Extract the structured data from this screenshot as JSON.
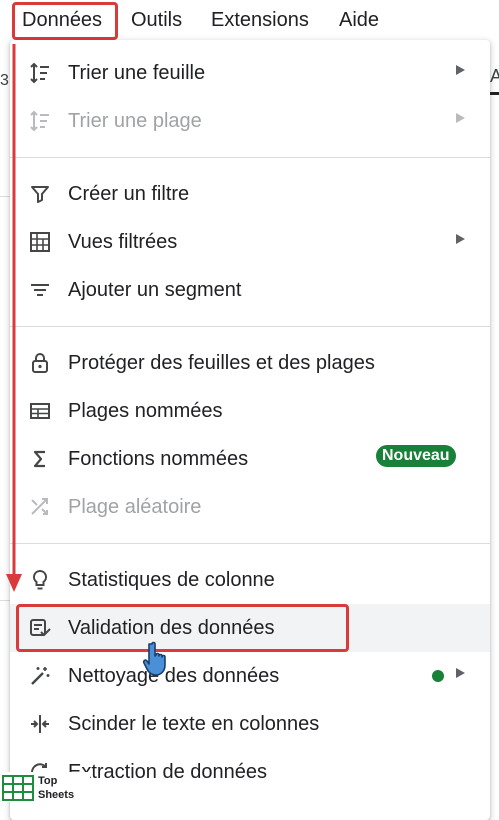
{
  "menubar": {
    "donnees": "Données",
    "outils": "Outils",
    "extensions": "Extensions",
    "aide": "Aide"
  },
  "background": {
    "left_fragment": "3",
    "right_fragment": "A"
  },
  "menu": {
    "trier_feuille": "Trier une feuille",
    "trier_plage": "Trier une plage",
    "creer_filtre": "Créer un filtre",
    "vues_filtrees": "Vues filtrées",
    "ajouter_segment": "Ajouter un segment",
    "proteger": "Protéger des feuilles et des plages",
    "plages_nommees": "Plages nommées",
    "fonctions_nommees": "Fonctions nommées",
    "nouveau_badge": "Nouveau",
    "plage_aleatoire": "Plage aléatoire",
    "statistiques": "Statistiques de colonne",
    "validation": "Validation des données",
    "nettoyage": "Nettoyage des données",
    "scinder": "Scinder le texte en colonnes",
    "extraction": "Extraction de données"
  },
  "logo": {
    "line1": "Top",
    "line2": "Sheets"
  },
  "colors": {
    "highlight_red": "#d93a3a",
    "badge_green": "#188038",
    "cursor_blue": "#4a90d9"
  }
}
